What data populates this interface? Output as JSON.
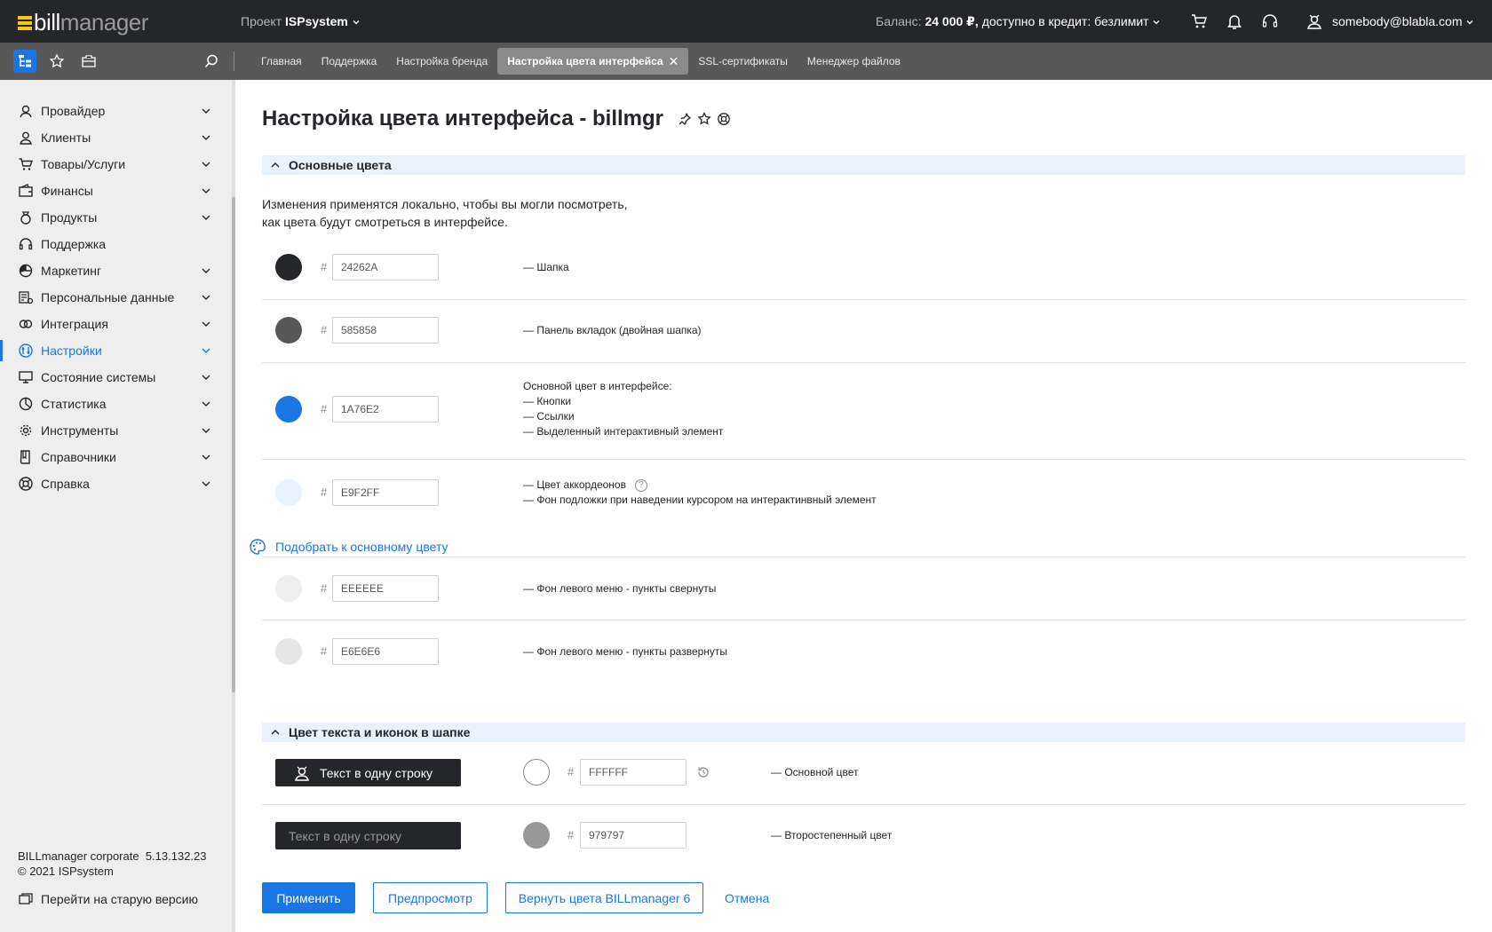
{
  "header": {
    "logo_part1": "bill",
    "logo_part2": "manager",
    "project_label": "Проект",
    "project_name": "ISPsystem",
    "balance_label": "Баланс:",
    "balance_value": "24 000 ₽,",
    "credit_text": "доступно в кредит: безлимит",
    "user_email": "somebody@blabla.com",
    "icons": [
      "cart-icon",
      "bell-icon",
      "headset-icon",
      "user-icon"
    ]
  },
  "tabbar": {
    "tabs": [
      {
        "label": "Главная"
      },
      {
        "label": "Поддержка"
      },
      {
        "label": "Настройка бренда"
      },
      {
        "label": "Настройка цвета интерфейса",
        "active": true
      },
      {
        "label": "SSL-сертификаты"
      },
      {
        "label": "Менеджер файлов"
      }
    ],
    "close_glyph": "✕"
  },
  "sidebar": {
    "items": [
      {
        "label": "Провайдер",
        "icon": "provider-icon",
        "expandable": true
      },
      {
        "label": "Клиенты",
        "icon": "clients-icon",
        "expandable": true
      },
      {
        "label": "Товары/Услуги",
        "icon": "cart-icon",
        "expandable": true
      },
      {
        "label": "Финансы",
        "icon": "wallet-icon",
        "expandable": true
      },
      {
        "label": "Продукты",
        "icon": "products-icon",
        "expandable": true
      },
      {
        "label": "Поддержка",
        "icon": "headset-icon",
        "expandable": false
      },
      {
        "label": "Маркетинг",
        "icon": "pie-icon",
        "expandable": true
      },
      {
        "label": "Персональные данные",
        "icon": "personal-data-icon",
        "expandable": true
      },
      {
        "label": "Интеграция",
        "icon": "integration-icon",
        "expandable": true
      },
      {
        "label": "Настройки",
        "icon": "settings-icon",
        "expandable": true,
        "active": true
      },
      {
        "label": "Состояние системы",
        "icon": "monitor-icon",
        "expandable": true
      },
      {
        "label": "Статистика",
        "icon": "statistics-icon",
        "expandable": true
      },
      {
        "label": "Инструменты",
        "icon": "gear-icon",
        "expandable": true
      },
      {
        "label": "Справочники",
        "icon": "book-icon",
        "expandable": true
      },
      {
        "label": "Справка",
        "icon": "help-icon",
        "expandable": true
      }
    ],
    "version_name": "BILLmanager corporate",
    "version_number": "5.13.132.23",
    "copyright": "© 2021 ISPsystem",
    "old_version_link": "Перейти на старую версию"
  },
  "main": {
    "title": "Настройка цвета интерфейса - billmgr",
    "section1_title": "Основные цвета",
    "description_line1": "Изменения применятся локально, чтобы вы могли посмотреть,",
    "description_line2": "как цвета будут смотреться в интерфейсе.",
    "hash": "#",
    "colors": [
      {
        "hex": "24262A",
        "swatch": "#24262A",
        "labels": [
          "— Шапка"
        ]
      },
      {
        "hex": "585858",
        "swatch": "#585858",
        "labels": [
          "— Панель вкладок (двойная шапка)"
        ]
      },
      {
        "hex": "1A76E2",
        "swatch": "#1A76E2",
        "labels": [
          "Основной цвет в интерфейсе:",
          "— Кнопки",
          "— Ссылки",
          "— Выделенный интерактивный элемент"
        ]
      },
      {
        "hex": "E9F2FF",
        "swatch": "#E9F2FF",
        "labels": [
          "— Цвет аккордеонов",
          "— Фон подложки при наведении курсором на интерактинвный элемент"
        ],
        "help": "?"
      },
      {
        "hex": "EEEEEE",
        "swatch": "#EEEEEE",
        "labels": [
          "— Фон левого меню - пункты свернуты"
        ]
      },
      {
        "hex": "E6E6E6",
        "swatch": "#E6E6E6",
        "labels": [
          "— Фон левого меню - пункты развернуты"
        ]
      }
    ],
    "pick_link": "Подобрать к основному цвету",
    "section2_title": "Цвет текста и иконок в шапке",
    "header_colors": [
      {
        "preview_text": "Текст в одну строку",
        "text_color": "#FFFFFF",
        "hex": "FFFFFF",
        "swatch": "#FFFFFF",
        "label": "— Основной цвет"
      },
      {
        "preview_text": "Текст в одну строку",
        "text_color": "#979797",
        "hex": "979797",
        "swatch": "#979797",
        "label": "— Второстепенный цвет"
      }
    ],
    "buttons": {
      "apply": "Применить",
      "preview": "Предпросмотр",
      "restore": "Вернуть цвета BILLmanager 6",
      "cancel": "Отмена"
    }
  }
}
